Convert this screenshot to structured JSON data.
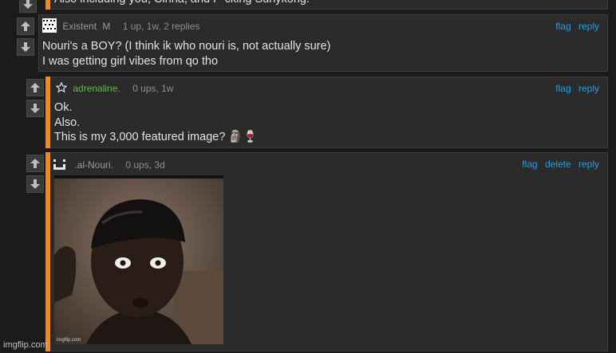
{
  "top_comment": {
    "text": "Also including you, Cinna, and F*cking Sunykong."
  },
  "comments": [
    {
      "user": "Existent",
      "badge": "M",
      "stats": "1 up, 1w, 2 replies",
      "lines": [
        "Nouri's a BOY? (I think ik who nouri is, not actually sure)",
        "I was getting girl vibes from qo tho"
      ],
      "actions": [
        "flag",
        "reply"
      ]
    },
    {
      "user": "adrenaline.",
      "stats": "0 ups, 1w",
      "lines": [
        "Ok.",
        "Also.",
        "This is my 3,000 featured image? 🗿🍷"
      ],
      "actions": [
        "flag",
        "reply"
      ]
    },
    {
      "user": ".al-Nouri.",
      "stats": "0 ups, 3d",
      "lines": [],
      "actions": [
        "flag",
        "delete",
        "reply"
      ],
      "image_caption": "imgflip.com"
    }
  ],
  "watermark": "imgflip.com",
  "colors": {
    "accent": "#f08a24",
    "link": "#1ba1e2",
    "green_user": "#5bbf3a"
  }
}
